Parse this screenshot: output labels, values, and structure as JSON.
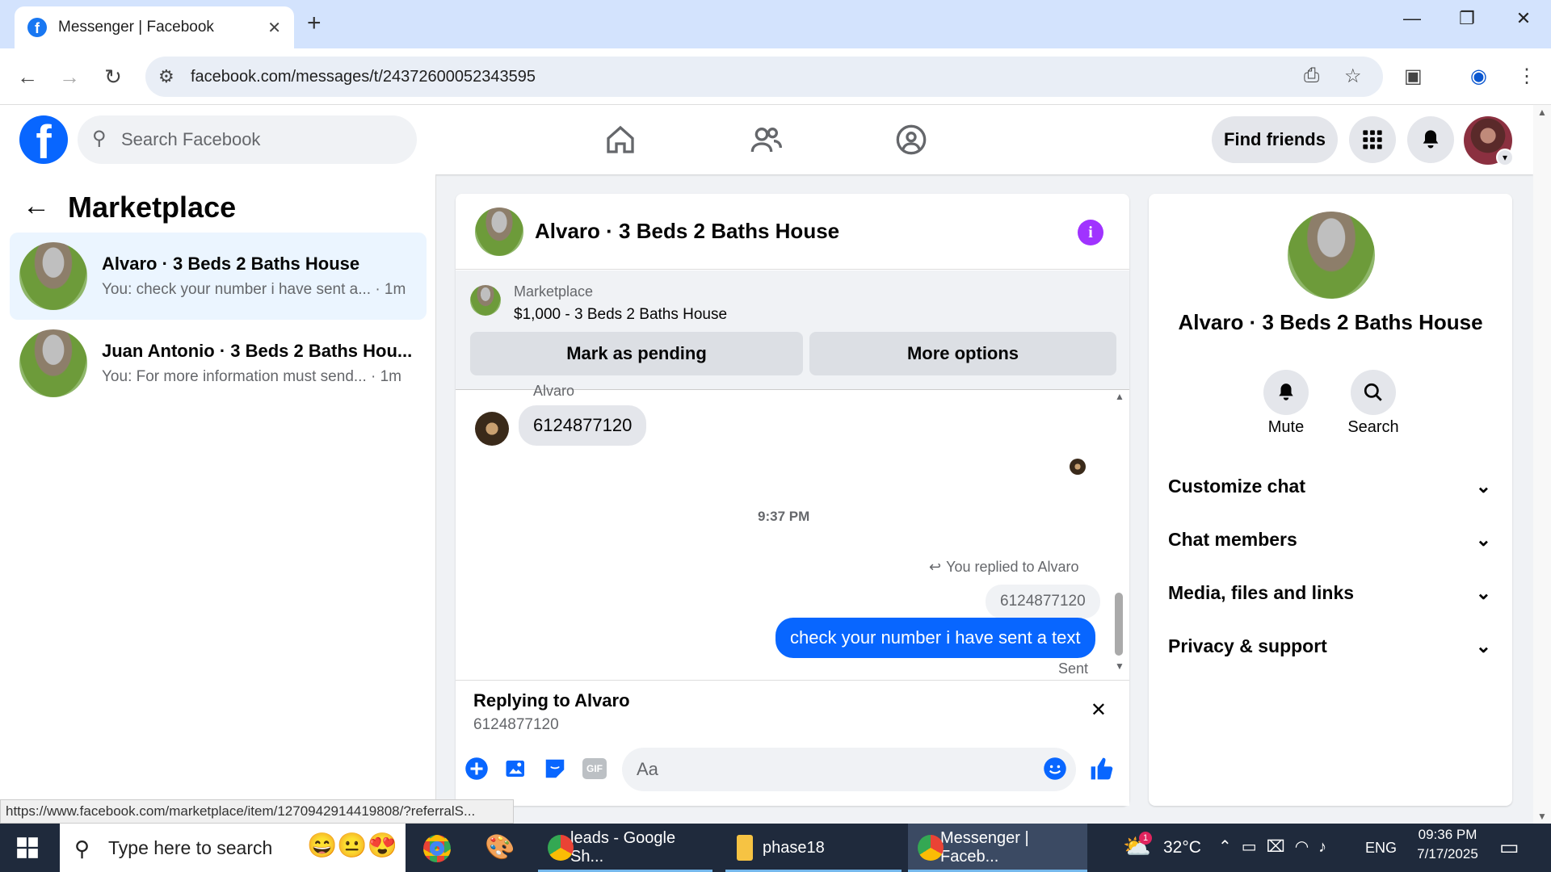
{
  "browser": {
    "tab_title": "Messenger | Facebook",
    "tab_close": "✕",
    "new_tab": "+",
    "url": "facebook.com/messages/t/24372600052343595",
    "window_min": "—",
    "window_restore": "❐",
    "window_close": "✕"
  },
  "fb_header": {
    "logo": "f",
    "search_placeholder": "Search Facebook",
    "find_friends": "Find friends"
  },
  "sidebar": {
    "title": "Marketplace",
    "conversations": [
      {
        "name": "Alvaro · 3 Beds 2 Baths House",
        "preview": "You: check your number i have sent a... · 1m",
        "selected": true
      },
      {
        "name": "Juan Antonio · 3 Beds 2 Baths Hou...",
        "preview": "You: For more information must send... · 1m",
        "selected": false
      }
    ]
  },
  "chat": {
    "title": "Alvaro · 3 Beds 2 Baths House",
    "listing_label": "Marketplace",
    "listing_price": "$1,000 - 3 Beds 2 Baths House",
    "mark_pending": "Mark as pending",
    "more_options": "More options",
    "sender_name": "Alvaro",
    "incoming_message": "6124877120",
    "timestamp": "9:37 PM",
    "replied_to": "You replied to Alvaro",
    "quoted_message": "6124877120",
    "outgoing_message": "check your number i have sent a text",
    "status": "Sent",
    "replying_to": "Replying to Alvaro",
    "replying_quote": "6124877120",
    "composer_placeholder": "Aa"
  },
  "info_panel": {
    "name": "Alvaro · 3 Beds 2 Baths House",
    "mute": "Mute",
    "search": "Search",
    "sections": [
      "Customize chat",
      "Chat members",
      "Media, files and links",
      "Privacy & support"
    ]
  },
  "status_link": "https://www.facebook.com/marketplace/item/1270942914419808/?referralS...",
  "taskbar": {
    "search_placeholder": "Type here to search",
    "apps": [
      "leads - Google Sh...",
      "phase18",
      "Messenger | Faceb..."
    ],
    "temperature": "32°C",
    "language": "ENG",
    "time": "09:36 PM",
    "date": "7/17/2025",
    "weather_badge": "1"
  },
  "colors": {
    "fb_blue": "#0866ff",
    "info_purple": "#a033ff",
    "taskbar": "#1f2a3c"
  }
}
